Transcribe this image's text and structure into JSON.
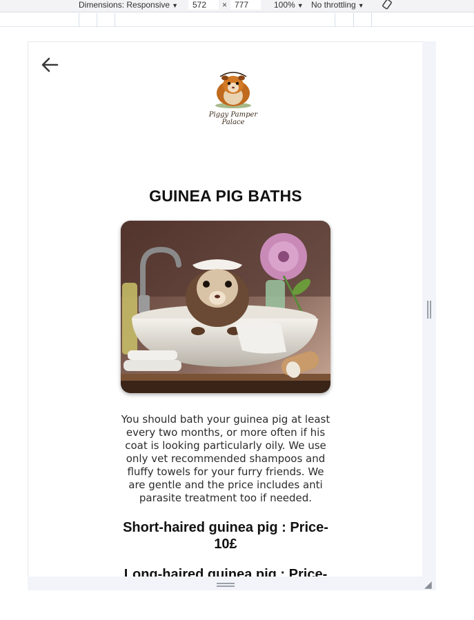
{
  "devtools": {
    "dimensions_label": "Dimensions: Responsive",
    "width_value": "572",
    "height_value": "777",
    "times": "×",
    "zoom": "100%",
    "throttling": "No throttling",
    "caret": "▼"
  },
  "header": {
    "back_icon": "arrow-left-icon",
    "logo_text_line1": "Piggy Pamper",
    "logo_text_line2": "Palace"
  },
  "main": {
    "title": "GUINEA PIG BATHS",
    "image_subject": "guinea pig in bath illustration",
    "description": "You should bath your guinea pig at least every two months, or more often if his coat is looking particularly oily. We use only vet recommended shampoos and fluffy towels for your furry friends. We are gentle and the price includes anti parasite treatment too if needed.",
    "prices": [
      {
        "label": "Short-haired guinea pig : Price- 10£"
      },
      {
        "label": "Long-haired guinea pig : Price-"
      }
    ]
  },
  "colors": {
    "text": "#111111",
    "frame": "#f2f4f9"
  }
}
